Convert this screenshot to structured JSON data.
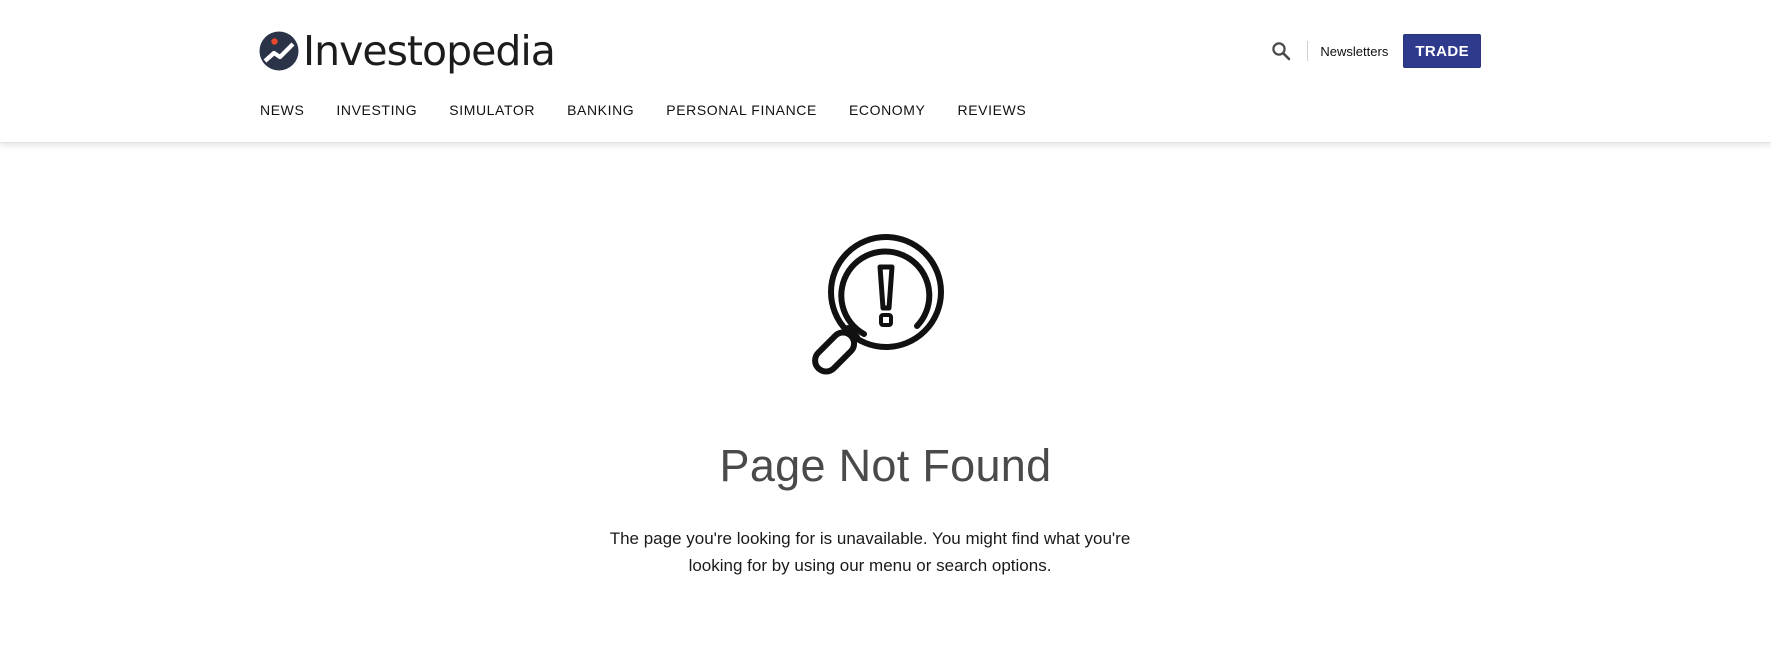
{
  "brand": {
    "name": "Investopedia",
    "logo_icon": "investopedia-logo-mark",
    "logo_color": "#2b3349",
    "logo_accent": "#e8492b"
  },
  "header": {
    "search_icon": "search-icon",
    "newsletters_label": "Newsletters",
    "trade_label": "TRADE",
    "trade_color": "#2e3a8c"
  },
  "nav": {
    "items": [
      {
        "label": "NEWS"
      },
      {
        "label": "INVESTING"
      },
      {
        "label": "SIMULATOR"
      },
      {
        "label": "BANKING"
      },
      {
        "label": "PERSONAL FINANCE"
      },
      {
        "label": "ECONOMY"
      },
      {
        "label": "REVIEWS"
      }
    ]
  },
  "main": {
    "icon": "magnifier-exclamation-icon",
    "title": "Page Not Found",
    "message": "The page you're looking for is unavailable. You might find what you're looking for by using our menu or search options."
  }
}
